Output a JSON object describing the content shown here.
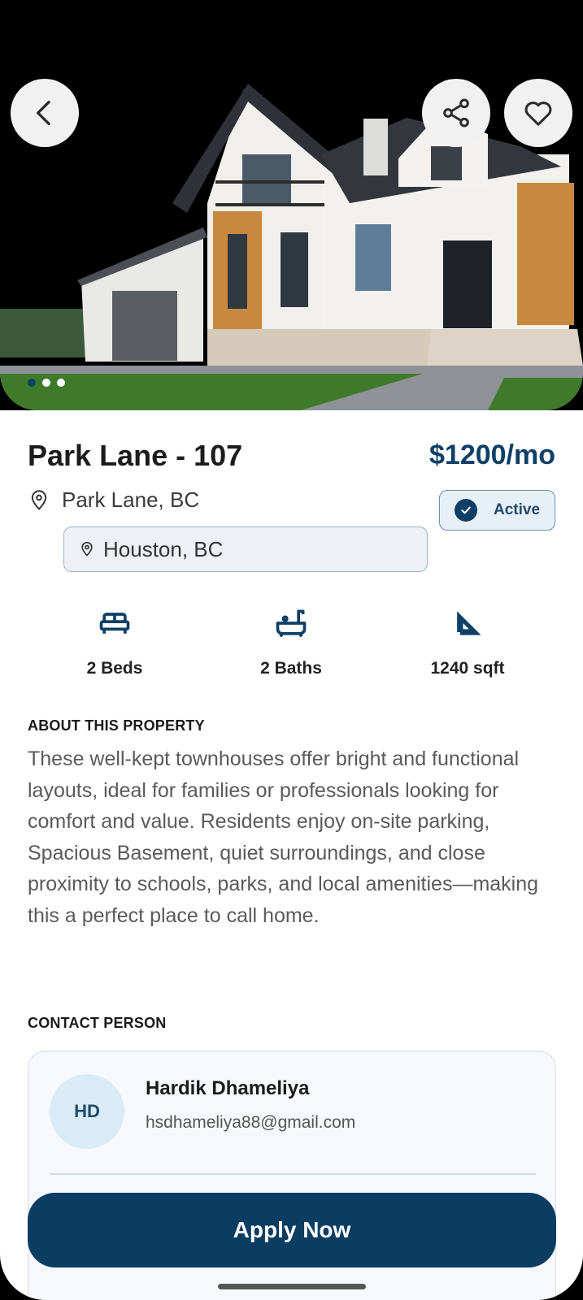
{
  "hero": {
    "image_alt": "Modern two-storey house with garage",
    "back_icon": "chevron-left-icon",
    "share_icon": "share-icon",
    "favorite_icon": "heart-icon",
    "carousel": {
      "count": 3,
      "active_index": 0
    }
  },
  "property": {
    "title": "Park Lane - 107",
    "price": "$1200/mo",
    "address": "Park Lane, BC",
    "city": "Houston, BC",
    "status": "Active",
    "features": {
      "beds": "2 Beds",
      "baths": "2 Baths",
      "area": "1240 sqft"
    }
  },
  "about": {
    "heading": "ABOUT THIS PROPERTY",
    "text": "These well-kept townhouses offer bright and functional layouts, ideal for families or professionals looking for comfort and value. Residents enjoy on-site parking, Spacious Basement, quiet surroundings, and close proximity to schools, parks, and local amenities—making this a perfect place to call home."
  },
  "contact": {
    "heading": "CONTACT PERSON",
    "initials": "HD",
    "name": "Hardik Dhameliya",
    "email": "hsdhameliya88@gmail.com"
  },
  "cta": {
    "label": "Apply Now"
  },
  "colors": {
    "primary": "#0b3d62",
    "price": "#0e3f66",
    "badge_bg": "#e8f0f7",
    "avatar_bg": "#d8ebf6"
  }
}
